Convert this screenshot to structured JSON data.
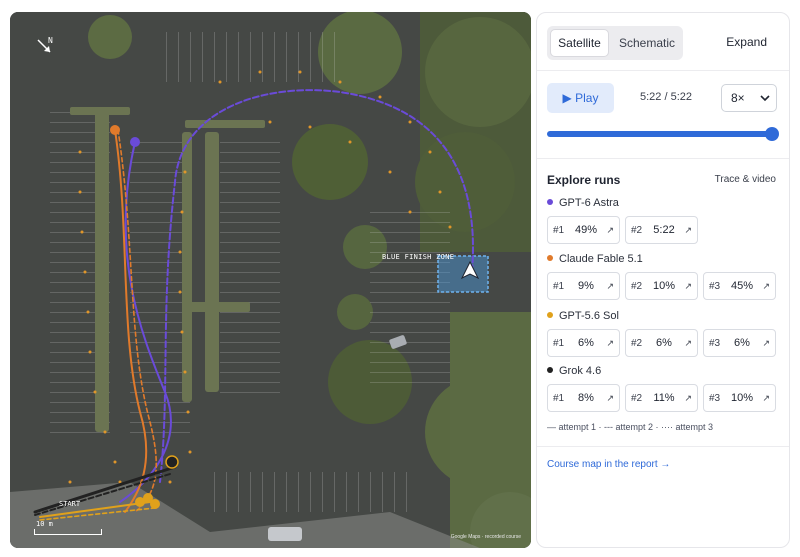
{
  "map": {
    "compass_label": "N",
    "finish_label": "BLUE FINISH ZONE",
    "start_label": "START",
    "scale_label": "10 m",
    "attribution": "Google Maps · recorded course"
  },
  "view_toggle": {
    "options": [
      "Satellite",
      "Schematic"
    ],
    "selected": "Satellite",
    "expand_label": "Expand"
  },
  "playback": {
    "play_label": "▶ Play",
    "time": "5:22 / 5:22",
    "speed": "8×",
    "progress": 1.0
  },
  "explore": {
    "title": "Explore runs",
    "subtitle": "Trace & video",
    "models": [
      {
        "name": "GPT-6 Astra",
        "color": "#6a4bd8",
        "runs": [
          {
            "num": "#1",
            "value": "49%"
          },
          {
            "num": "#2",
            "value": "5:22"
          }
        ]
      },
      {
        "name": "Claude Fable 5.1",
        "color": "#e07a2b",
        "runs": [
          {
            "num": "#1",
            "value": "9%"
          },
          {
            "num": "#2",
            "value": "10%"
          },
          {
            "num": "#3",
            "value": "45%"
          }
        ]
      },
      {
        "name": "GPT-5.6 Sol",
        "color": "#e0a11b",
        "runs": [
          {
            "num": "#1",
            "value": "6%"
          },
          {
            "num": "#2",
            "value": "6%"
          },
          {
            "num": "#3",
            "value": "6%"
          }
        ]
      },
      {
        "name": "Grok 4.6",
        "color": "#222222",
        "runs": [
          {
            "num": "#1",
            "value": "8%"
          },
          {
            "num": "#2",
            "value": "11%"
          },
          {
            "num": "#3",
            "value": "10%"
          }
        ]
      }
    ],
    "attempt_legend": "— attempt 1 · --- attempt 2 · ···· attempt 3",
    "report_link": "Course map in the report →"
  },
  "colors": {
    "accent": "#2f6ad8",
    "finish_zone": "#4a9be0"
  }
}
